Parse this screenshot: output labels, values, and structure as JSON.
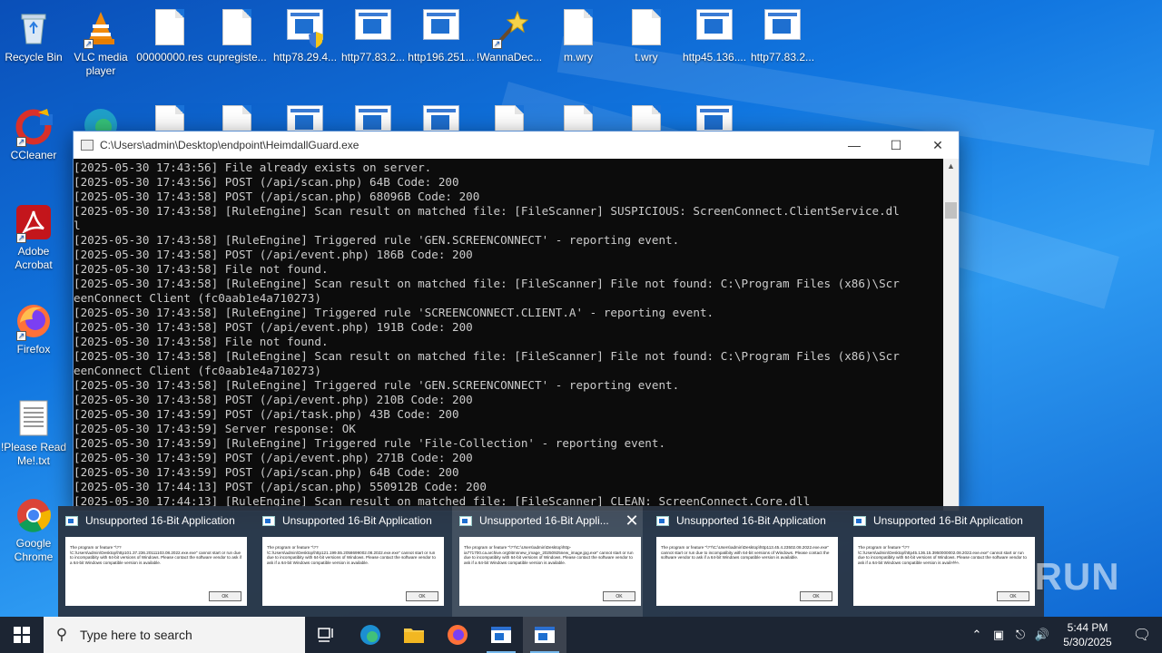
{
  "desktop_icons": [
    {
      "label": "Recycle Bin",
      "icon": "recycle-bin-icon"
    },
    {
      "label": "VLC media player",
      "icon": "vlc-icon"
    },
    {
      "label": "00000000.res",
      "icon": "file-icon"
    },
    {
      "label": "cupregiste...",
      "icon": "file-icon"
    },
    {
      "label": "http78.29.4...",
      "icon": "exe-shield-icon"
    },
    {
      "label": "http77.83.2...",
      "icon": "exe-icon"
    },
    {
      "label": "http196.251...",
      "icon": "exe-icon"
    },
    {
      "label": "!WannaDec...",
      "icon": "wand-icon"
    },
    {
      "label": "m.wry",
      "icon": "file-icon"
    },
    {
      "label": "t.wry",
      "icon": "file-icon"
    },
    {
      "label": "http45.136....",
      "icon": "exe-icon"
    },
    {
      "label": "http77.83.2...",
      "icon": "exe-icon"
    },
    {
      "label": "CCleaner",
      "icon": "ccleaner-icon"
    },
    {
      "label": "Adobe Acrobat",
      "icon": "acrobat-icon"
    },
    {
      "label": "Firefox",
      "icon": "firefox-icon"
    },
    {
      "label": "!Please Read Me!.txt",
      "icon": "text-file-icon"
    },
    {
      "label": "Google Chrome",
      "icon": "chrome-icon"
    }
  ],
  "console": {
    "title": "C:\\Users\\admin\\Desktop\\endpoint\\HeimdallGuard.exe",
    "lines": [
      "[2025-05-30 17:43:56] File already exists on server.",
      "[2025-05-30 17:43:56] POST (/api/scan.php) 64B Code: 200",
      "[2025-05-30 17:43:58] POST (/api/scan.php) 68096B Code: 200",
      "[2025-05-30 17:43:58] [RuleEngine] Scan result on matched file: [FileScanner] SUSPICIOUS: ScreenConnect.ClientService.dl",
      "l",
      "[2025-05-30 17:43:58] [RuleEngine] Triggered rule 'GEN.SCREENCONNECT' - reporting event.",
      "[2025-05-30 17:43:58] POST (/api/event.php) 186B Code: 200",
      "[2025-05-30 17:43:58] File not found.",
      "[2025-05-30 17:43:58] [RuleEngine] Scan result on matched file: [FileScanner] File not found: C:\\Program Files (x86)\\Scr",
      "eenConnect Client (fc0aab1e4a710273)",
      "[2025-05-30 17:43:58] [RuleEngine] Triggered rule 'SCREENCONNECT.CLIENT.A' - reporting event.",
      "[2025-05-30 17:43:58] POST (/api/event.php) 191B Code: 200",
      "[2025-05-30 17:43:58] File not found.",
      "[2025-05-30 17:43:58] [RuleEngine] Scan result on matched file: [FileScanner] File not found: C:\\Program Files (x86)\\Scr",
      "eenConnect Client (fc0aab1e4a710273)",
      "[2025-05-30 17:43:58] [RuleEngine] Triggered rule 'GEN.SCREENCONNECT' - reporting event.",
      "[2025-05-30 17:43:58] POST (/api/event.php) 210B Code: 200",
      "[2025-05-30 17:43:59] POST (/api/task.php) 43B Code: 200",
      "[2025-05-30 17:43:59] Server response: OK",
      "[2025-05-30 17:43:59] [RuleEngine] Triggered rule 'File-Collection' - reporting event.",
      "[2025-05-30 17:43:59] POST (/api/event.php) 271B Code: 200",
      "[2025-05-30 17:43:59] POST (/api/scan.php) 64B Code: 200",
      "[2025-05-30 17:44:13] POST (/api/scan.php) 550912B Code: 200",
      "[2025-05-30 17:44:13] [RuleEngine] Scan result on matched file: [FileScanner] CLEAN: ScreenConnect.Core.dll"
    ]
  },
  "previews": [
    {
      "title": "Unsupported 16-Bit Application",
      "body": "The program or feature \"\\??\\C:\\Users\\admin\\Desktop\\http101.37.236.20111103.08.2022.exe.exe\" cannot start or run due to incompatibity with 64-bit versions of Windows. Please contact the software vendor to ask if a 64-bit Windows compatible version is available.",
      "ok": "OK"
    },
    {
      "title": "Unsupported 16-Bit Application",
      "body": "The program or feature \"\\??\\C:\\Users\\admin\\Desktop\\http121.199.55.2058699002.08.2022.exe.exe\" cannot start or run due to incompatibity with 64-bit versions of Windows. Please contact the software vendor to ask if a 64-bit Windows compatible version is available.",
      "ok": "OK"
    },
    {
      "title": "Unsupported 16-Bit Appli...",
      "body": "The program or feature \"\\??\\C:\\Users\\admin\\Desktop\\http-ia771700.ca.archive.org0itmnnew_image_20250925new_image.jpg.exe\" cannot start or run due to incompatibity with 64-bit versions of Windows. Please contact the software vendor to ask if a 64-bit Windows compatible version is available.",
      "ok": "OK"
    },
    {
      "title": "Unsupported 16-Bit Application",
      "body": "The program or feature \"\\??\\C:\\Users\\admin\\Desktop\\http113.45.4.23502.08.2022.exe.exe\" cannot start or run due to incompatibity with 64-bit versions of Windows. Please contact the software vendor to ask if a 64-bit Windows compatible version is available.",
      "ok": "OK"
    },
    {
      "title": "Unsupported 16-Bit Application",
      "body": "The program or feature \"\\??\\C:\\Users\\admin\\Desktop\\http45.136.15.3950000002.08.2022.exe.exe\" cannot start or run due to incompatibity with 64-bit versions of Windows. Please contact the software vendor to ask if a 64-bit Windows compatible version is available.",
      "ok": "OK"
    }
  ],
  "watermark": "ANY RUN",
  "taskbar": {
    "search_placeholder": "Type here to search",
    "time": "5:44 PM",
    "date": "5/30/2025"
  }
}
